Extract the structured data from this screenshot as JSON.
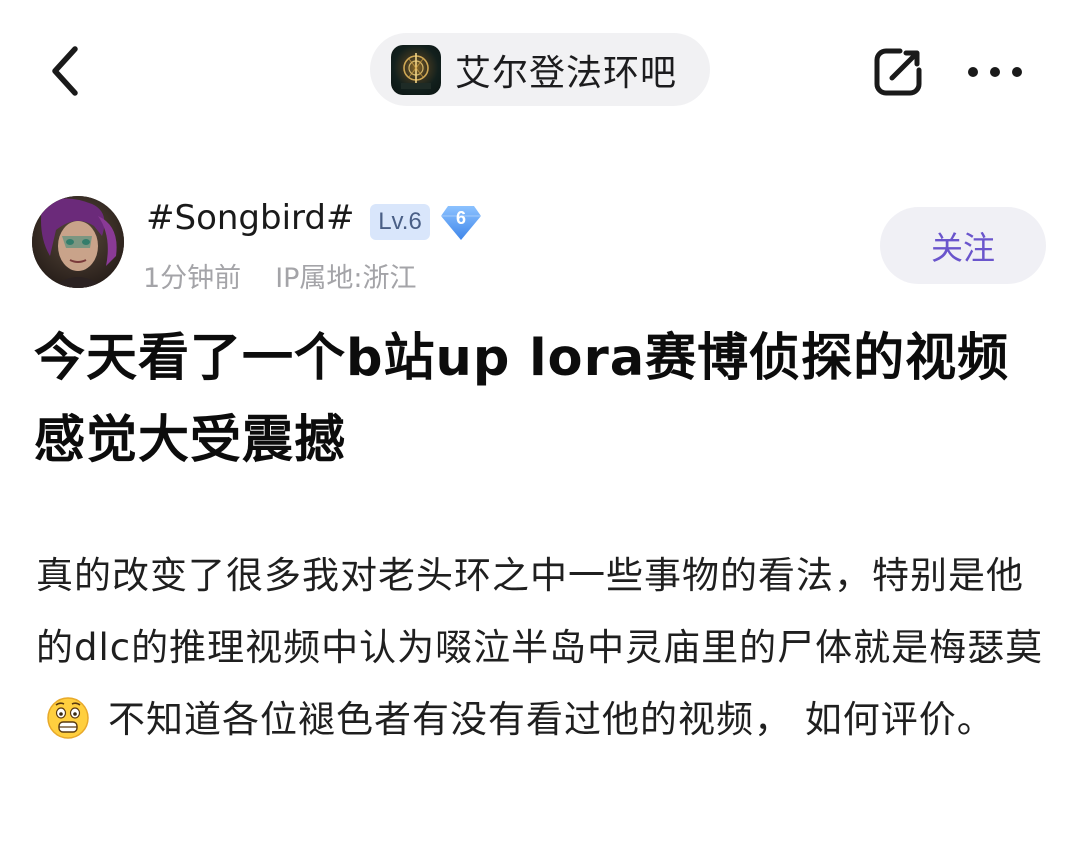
{
  "nav": {
    "back_icon": "chevron-left-icon",
    "forum_name": "艾尔登法环吧",
    "forum_logo": "elden-ring-logo",
    "share_icon": "share-edit-icon",
    "more_icon": "more-dots-icon"
  },
  "author": {
    "name": "#Songbird#",
    "level": "Lv.6",
    "diamond_level": "6",
    "time": "1分钟前",
    "ip": "IP属地:浙江",
    "follow_label": "关注"
  },
  "post": {
    "title": "今天看了一个b站up lora赛博侦探的视频感觉大受震撼",
    "body_before_emoji": "真的改变了很多我对老头环之中一些事物的看法，特别是他的dlc的推理视频中认为啜泣半岛中灵庙里的尸体就是梅瑟莫",
    "emoji": "shocked-face-emoji",
    "body_after_emoji": "不知道各位褪色者有没有看过他的视频， 如何评价。"
  },
  "colors": {
    "accent": "#6a55cc",
    "pill_bg": "#f1f1f3",
    "level_badge_bg": "#d9e6fb",
    "diamond": "#5b9bf0",
    "meta_text": "#a4a4a8"
  }
}
